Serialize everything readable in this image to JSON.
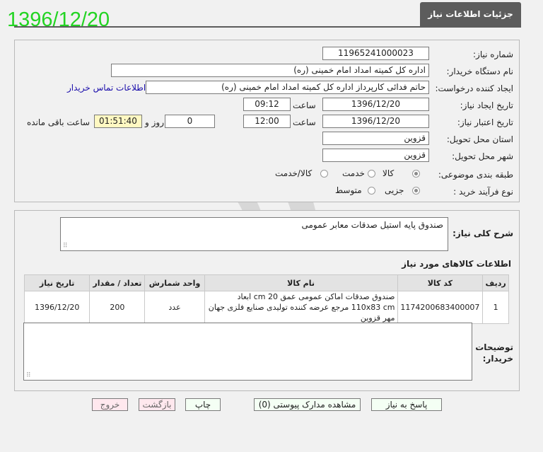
{
  "stamp_date": "1396/12/20",
  "header": {
    "title": "جزئیات اطلاعات نیاز"
  },
  "form": {
    "need_number": {
      "label": "شماره نیاز:",
      "value": "11965241000023"
    },
    "buyer_org": {
      "label": "نام دستگاه خریدار:",
      "value": "اداره کل کمیته امداد امام خمینی (ره)"
    },
    "requester": {
      "label": "ایجاد کننده درخواست:",
      "value": "حاتم فدائی کارپرداز اداره کل کمیته امداد امام خمینی (ره)",
      "contact_link": "اطلاعات تماس خریدار"
    },
    "creation": {
      "label": "تاریخ ایجاد نیاز:",
      "date": "1396/12/20",
      "time_label": "ساعت",
      "time": "09:12"
    },
    "validity": {
      "label": "تاریخ اعتبار نیاز:",
      "date": "1396/12/20",
      "time_label": "ساعت",
      "time": "12:00",
      "days": "0",
      "days_label": "روز و",
      "remaining": "01:51:40",
      "remaining_label": "ساعت باقی مانده"
    },
    "province": {
      "label": "استان محل تحویل:",
      "value": "قزوین"
    },
    "city": {
      "label": "شهر محل تحویل:",
      "value": "قزوین"
    },
    "category": {
      "label": "طبقه بندی موضوعی:",
      "options": [
        "کالا",
        "خدمت",
        "کالا/خدمت"
      ],
      "selected": "کالا"
    },
    "purchase_type": {
      "label": "نوع فرآیند خرید :",
      "options": [
        "جزیی",
        "متوسط"
      ],
      "selected": "جزیی"
    }
  },
  "summary": {
    "label": "شرح کلی نیاز:",
    "value": "صندوق پایه استیل صدقات معابر عمومی"
  },
  "items": {
    "title": "اطلاعات کالاهای مورد نیاز",
    "columns": [
      "ردیف",
      "کد کالا",
      "نام کالا",
      "واحد شمارش",
      "تعداد / مقدار",
      "تاریخ نیاز"
    ],
    "rows": [
      {
        "row": "1",
        "code": "1174200683400007",
        "name": "صندوق صدقات اماکن عمومی عمق 20 cm ابعاد 110x83 cm مرجع عرضه کننده تولیدی صنایع فلزی جهان مهر قزوین",
        "unit": "عدد",
        "qty": "200",
        "date": "1396/12/20"
      }
    ]
  },
  "notes": {
    "label": "توضیحات خریدار:",
    "value": ""
  },
  "buttons": {
    "reply": "پاسخ به نیاز",
    "attachments": "مشاهده مدارک پیوستی (0)",
    "print": "چاپ",
    "back": "بازگشت",
    "exit": "خروج"
  },
  "watermark": {
    "text": "هزاره"
  }
}
